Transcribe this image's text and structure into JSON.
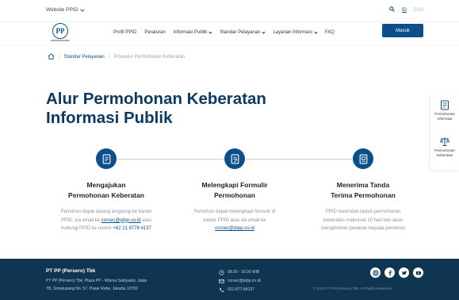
{
  "topbar": {
    "site_selector": "Website PPID",
    "lang_id": "ID",
    "lang_eng": "ENG"
  },
  "nav": {
    "logo_text": "PP",
    "menu": [
      {
        "label": "Profil PPID",
        "has_dropdown": false
      },
      {
        "label": "Peraturan",
        "has_dropdown": false
      },
      {
        "label": "Informasi Publik",
        "has_dropdown": true
      },
      {
        "label": "Standar Pelayanan",
        "has_dropdown": true
      },
      {
        "label": "Layanan Informasi",
        "has_dropdown": true
      },
      {
        "label": "FAQ",
        "has_dropdown": false
      }
    ],
    "login_label": "Masuk"
  },
  "breadcrumb": {
    "level1": "Standar Pelayanan",
    "separator": "/",
    "current": "Prosedur Permohonan Keberatan"
  },
  "page": {
    "title_line1": "Alur Permohonan Keberatan",
    "title_line2": "Informasi Publik"
  },
  "side_panel": {
    "item1_line1": "Permohonan",
    "item1_line2": "Informasi",
    "item2_line1": "Permohonan",
    "item2_line2": "Keberatan"
  },
  "steps": [
    {
      "title_line1": "Mengajukan",
      "title_line2": "Permohonan Keberatan",
      "desc_line1": "Pemohon dapat datang langsung ke kantor",
      "desc_line2_a": "PPID, via email ke ",
      "desc_line2_link": "corsec@ptpp.co.id",
      "desc_line2_b": " atau",
      "desc_line3_a": "hubungi PPID ke nomor ",
      "desc_line3_link": "+62 21 8778 4137"
    },
    {
      "title_line1": "Melengkapi Formulir",
      "title_line2": "Permohonan",
      "desc_line1": "Pemohon dapat melengkapi formulir di",
      "desc_line2": "kantor PPID atau via email ke",
      "desc_line3_link": "corsec@ptpp.co.id"
    },
    {
      "title_line1": "Menerima Tanda",
      "title_line2": "Terima Permohonan",
      "desc_line1": "PPID menindak lanjuti permohonan",
      "desc_line2": "keberatan maksimal 10 hari dan akan",
      "desc_line3": "mengirimkan jawaban kepada pemohon"
    }
  ],
  "footer": {
    "company": "PT PP (Persero) Tbk",
    "address_line1": "PT PP (Persero) Tbk, Plaza PP - Wisma Subiyanto, Jalan",
    "address_line2": "TB. Simatupang No. 57, Pasar Rebo, Jakarta 13760",
    "hours": "08.00 - 16.00 WIB",
    "email": "corsec@ptpp.co.id",
    "phone": "021-877-84137",
    "copyright": "© 2022 PT PP (Persero) Tbk. All Rights Reserved"
  },
  "colors": {
    "primary": "#0d4f8b",
    "title": "#0c3a62",
    "footer_bg": "#0f3550"
  }
}
